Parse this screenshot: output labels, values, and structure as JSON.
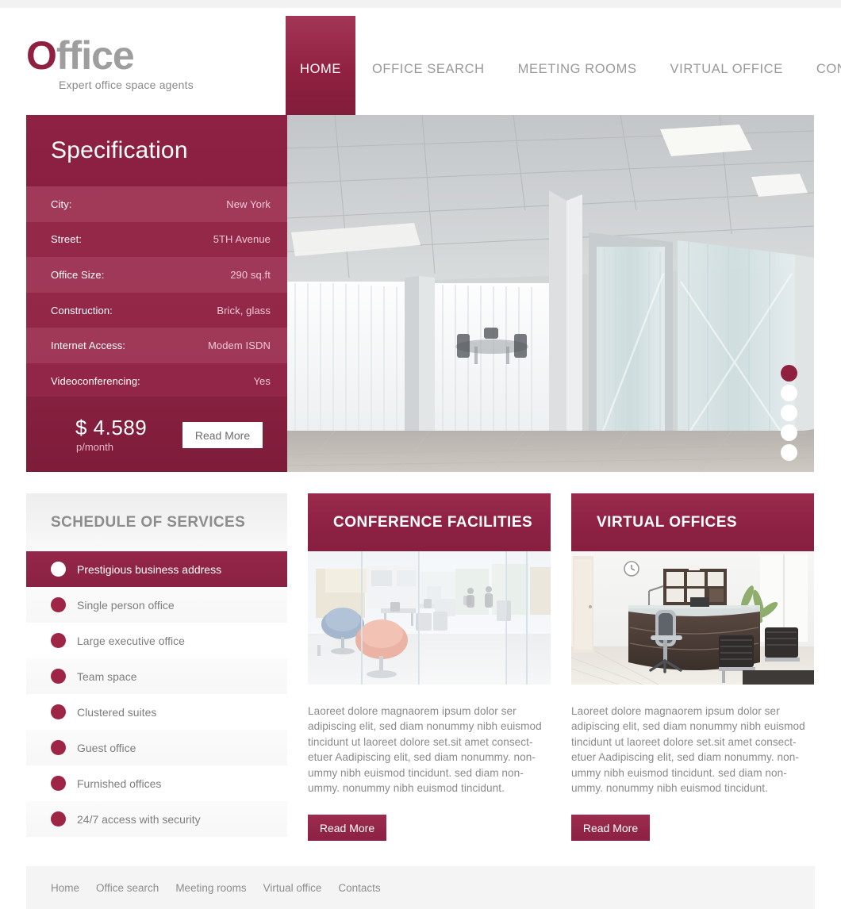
{
  "brand": {
    "name_first": "O",
    "name_rest": "ffice",
    "tagline": "Expert office space agents"
  },
  "nav": {
    "items": [
      {
        "label": "HOME",
        "active": true
      },
      {
        "label": "OFFICE SEARCH",
        "active": false
      },
      {
        "label": "MEETING ROOMS",
        "active": false
      },
      {
        "label": "VIRTUAL OFFICE",
        "active": false
      },
      {
        "label": "CONTACTS",
        "active": false
      }
    ]
  },
  "specification": {
    "title": "Specification",
    "rows": [
      {
        "key": "City:",
        "value": "New York"
      },
      {
        "key": "Street:",
        "value": "5TH Avenue"
      },
      {
        "key": "Office Size:",
        "value": "290 sq.ft"
      },
      {
        "key": "Construction:",
        "value": "Brick, glass"
      },
      {
        "key": "Internet Access:",
        "value": "Modem ISDN"
      },
      {
        "key": "Videoconferencing:",
        "value": "Yes"
      }
    ],
    "price_amount": "$ 4.589",
    "price_period": "p/month",
    "read_more": "Read More"
  },
  "slider": {
    "dots": [
      {
        "active": true
      },
      {
        "active": false
      },
      {
        "active": false
      },
      {
        "active": false
      },
      {
        "active": false
      }
    ]
  },
  "services": {
    "title": "SCHEDULE OF SERVICES",
    "items": [
      {
        "label": "Prestigious business address",
        "active": true
      },
      {
        "label": "Single person office",
        "active": false
      },
      {
        "label": "Large executive office",
        "active": false
      },
      {
        "label": "Team space",
        "active": false
      },
      {
        "label": "Clustered suites",
        "active": false
      },
      {
        "label": "Guest office",
        "active": false
      },
      {
        "label": "Furnished offices",
        "active": false
      },
      {
        "label": "24/7 access with security",
        "active": false
      }
    ]
  },
  "cards": [
    {
      "title": "CONFERENCE FACILITIES",
      "text": "Laoreet dolore magnaorem ipsum dolor ser adipiscing elit, sed diam nonummy nibh euismod tincidunt ut laoreet dolore set.sit amet consect-etuer Aadipiscing elit, sed diam nonummy. non-ummy nibh euismod tincidunt.  sed diam non-ummy. nonummy nibh euismod tincidunt.",
      "button": "Read More"
    },
    {
      "title": "VIRTUAL  OFFICES",
      "text": "Laoreet dolore magnaorem ipsum dolor ser adipiscing elit, sed diam nonummy nibh euismod tincidunt ut laoreet dolore set.sit amet consect-etuer Aadipiscing elit, sed diam nonummy. non-ummy nibh euismod tincidunt.  sed diam non-ummy. nonummy nibh euismod tincidunt.",
      "button": "Read More"
    }
  ],
  "footer": {
    "links": [
      "Home",
      "Office search",
      "Meeting rooms",
      "Virtual office",
      "Contacts"
    ]
  },
  "colors": {
    "brand_crimson": "#8f2040",
    "brand_crimson_light": "#9e2546",
    "text_gray": "#8a8a8a",
    "panel_gray": "#f4f4f4"
  }
}
